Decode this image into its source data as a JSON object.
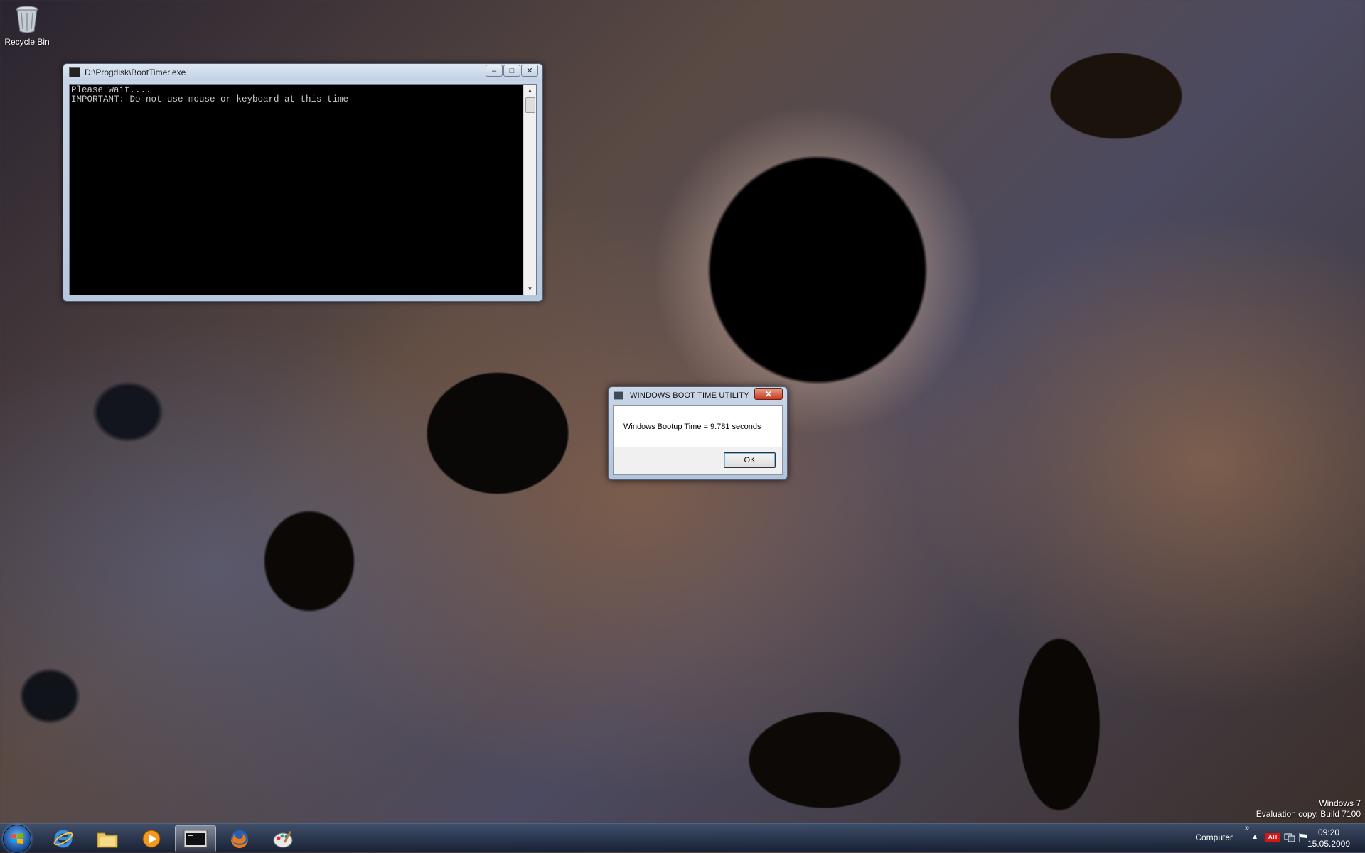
{
  "desktop": {
    "recycle_bin_label": "Recycle Bin"
  },
  "console": {
    "title": "D:\\Progdisk\\BootTimer.exe",
    "lines": [
      "Please wait....",
      "IMPORTANT: Do not use mouse or keyboard at this time"
    ],
    "minimize": "–",
    "maximize": "□",
    "close": "✕"
  },
  "dialog": {
    "title": "WINDOWS BOOT TIME UTILITY",
    "message": "Windows Bootup Time =  9.781  seconds",
    "ok_label": "OK",
    "close": "✕"
  },
  "watermark": {
    "line1": "Windows 7",
    "line2": "Evaluation copy. Build 7100"
  },
  "taskbar": {
    "pinned": [
      {
        "name": "internet-explorer",
        "icon": "ie-icon"
      },
      {
        "name": "explorer",
        "icon": "folder-icon"
      },
      {
        "name": "media-player",
        "icon": "media-player-icon"
      },
      {
        "name": "boottimer",
        "icon": "console-icon",
        "active": true
      },
      {
        "name": "firefox",
        "icon": "firefox-icon"
      },
      {
        "name": "paint",
        "icon": "paint-icon"
      }
    ],
    "computer_label": "Computer",
    "chevrons": "»",
    "tray_arrow": "▲",
    "ati_label": "ATI",
    "time": "09:20",
    "date": "15.05.2009"
  },
  "colors": {
    "taskbar": "#1e2d47",
    "console_bg": "#000000",
    "console_text": "#c8c8c8",
    "close_red": "#c63a1f"
  }
}
